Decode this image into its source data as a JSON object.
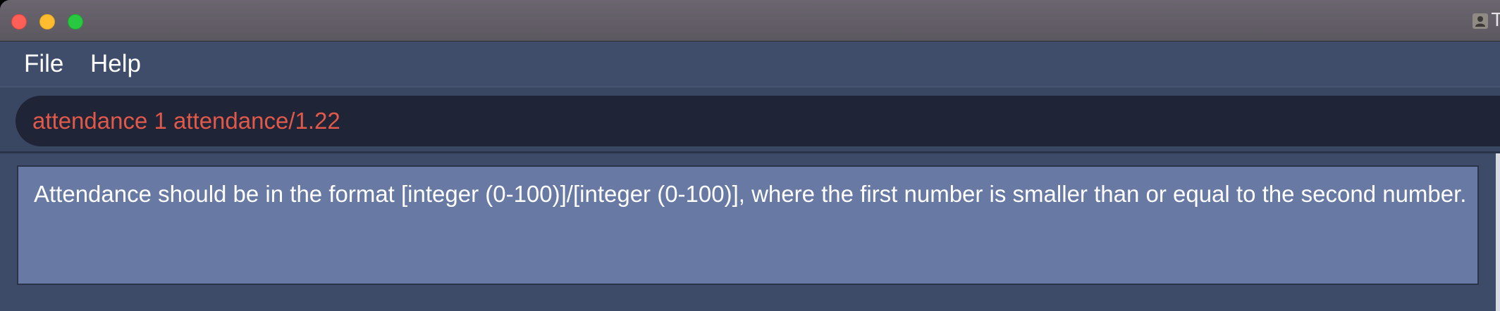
{
  "window": {
    "controls": [
      "close",
      "minimize",
      "maximize"
    ],
    "title_fragment": "T",
    "profile_icon": "person-icon"
  },
  "menu": {
    "items": [
      {
        "label": "File"
      },
      {
        "label": "Help"
      }
    ]
  },
  "command": {
    "value": "attendance 1 attendance/1.22",
    "text_color": "#e0594a"
  },
  "result": {
    "message": "Attendance should be in the format [integer (0-100)]/[integer (0-100)], where the first number is smaller than or equal to the second number."
  },
  "colors": {
    "background": "#3c4a66",
    "result_box": "#6879a3",
    "command_box": "#1f2436"
  }
}
